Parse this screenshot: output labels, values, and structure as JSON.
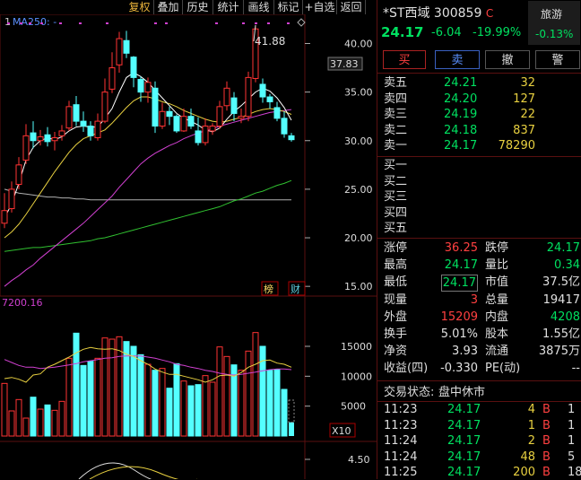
{
  "toolbar": {
    "items": [
      "复权",
      "叠加",
      "历史",
      "统计",
      "画线",
      "标记",
      "+自选",
      "返回"
    ]
  },
  "chart": {
    "indicator_marker": "1",
    "ma_label": "MA250: -",
    "price_axis": [
      "40.00",
      "35.00",
      "30.00",
      "25.00",
      "20.00",
      "15.00"
    ],
    "current_price_tag": "37.83",
    "high_annotation": "41.88",
    "badge_bang": "榜",
    "badge_cai": "财",
    "volume_header": "7200.16",
    "volume_axis": [
      "15000",
      "10000",
      "5000"
    ],
    "volume_unit": "X10",
    "lower_axis": "4.50"
  },
  "chart_data": {
    "type": "candlestick",
    "ylim": [
      14,
      43
    ],
    "candles": [
      [
        21.5,
        22.8,
        24.6,
        21.0
      ],
      [
        23.0,
        25.0,
        25.8,
        22.6
      ],
      [
        25.5,
        27.5,
        28.3,
        25.0
      ],
      [
        28.0,
        30.5,
        31.7,
        27.6
      ],
      [
        30.8,
        30.0,
        32.0,
        29.2
      ],
      [
        30.0,
        30.4,
        31.1,
        29.5
      ],
      [
        30.6,
        29.9,
        31.4,
        29.4
      ],
      [
        30.0,
        30.3,
        30.9,
        29.0
      ],
      [
        30.5,
        31.0,
        31.6,
        30.0
      ],
      [
        31.3,
        33.5,
        34.1,
        31.0
      ],
      [
        33.7,
        32.0,
        34.6,
        31.5
      ],
      [
        32.0,
        31.5,
        33.0,
        30.9
      ],
      [
        31.5,
        30.5,
        32.0,
        30.0
      ],
      [
        30.3,
        32.0,
        32.8,
        30.0
      ],
      [
        32.0,
        35.0,
        36.4,
        31.8
      ],
      [
        35.3,
        37.5,
        39.1,
        34.9
      ],
      [
        37.8,
        40.5,
        41.2,
        37.0
      ],
      [
        40.3,
        39.0,
        41.3,
        38.5
      ],
      [
        38.6,
        36.5,
        38.7,
        35.5
      ],
      [
        36.3,
        35.0,
        36.6,
        34.0
      ],
      [
        35.0,
        36.0,
        36.5,
        33.9
      ],
      [
        35.4,
        31.5,
        36.1,
        30.8
      ],
      [
        31.5,
        33.0,
        33.9,
        31.2
      ],
      [
        33.0,
        32.5,
        33.5,
        31.6
      ],
      [
        32.5,
        31.0,
        32.7,
        30.8
      ],
      [
        31.0,
        32.5,
        33.3,
        30.9
      ],
      [
        32.5,
        31.5,
        33.3,
        31.2
      ],
      [
        31.0,
        29.8,
        32.4,
        29.5
      ],
      [
        29.8,
        31.5,
        32.3,
        29.5
      ],
      [
        31.0,
        31.5,
        31.8,
        30.6
      ],
      [
        31.5,
        33.5,
        34.1,
        31.2
      ],
      [
        33.6,
        35.4,
        36.1,
        33.1
      ],
      [
        34.4,
        32.8,
        35.0,
        32.0
      ],
      [
        32.3,
        32.5,
        33.3,
        31.8
      ],
      [
        32.5,
        36.5,
        37.1,
        32.0
      ],
      [
        36.4,
        41.5,
        41.9,
        36.0
      ],
      [
        35.8,
        34.5,
        36.4,
        33.9
      ],
      [
        34.5,
        34.0,
        34.8,
        33.3
      ],
      [
        33.4,
        32.3,
        34.0,
        32.0
      ],
      [
        32.3,
        30.7,
        33.0,
        30.3
      ],
      [
        30.5,
        30.1,
        30.8,
        29.9
      ]
    ],
    "ma5": [
      22.0,
      23.5,
      25.6,
      28.0,
      29.3,
      30.0,
      30.3,
      30.1,
      30.4,
      31.0,
      31.4,
      31.5,
      31.4,
      31.4,
      32.3,
      33.3,
      35.0,
      36.5,
      37.0,
      36.6,
      36.0,
      35.2,
      34.4,
      33.6,
      32.8,
      32.3,
      32.0,
      31.6,
      31.1,
      30.9,
      31.3,
      32.2,
      33.0,
      33.6,
      34.3,
      35.0,
      35.4,
      35.1,
      34.4,
      33.4,
      32.1
    ],
    "ma10": [
      20.0,
      20.6,
      21.4,
      22.4,
      23.5,
      24.6,
      25.7,
      26.8,
      27.8,
      28.8,
      29.6,
      30.2,
      30.5,
      30.8,
      31.1,
      31.8,
      32.6,
      33.4,
      34.1,
      34.5,
      34.5,
      34.3,
      34.0,
      33.8,
      33.5,
      33.1,
      32.8,
      32.5,
      32.2,
      32.0,
      31.9,
      32.0,
      32.2,
      32.4,
      32.7,
      33.0,
      33.2,
      33.3,
      33.2,
      33.0,
      32.7
    ],
    "ma30": [
      15.0,
      15.6,
      16.1,
      16.7,
      17.2,
      17.9,
      18.5,
      19.1,
      19.7,
      20.3,
      20.9,
      21.5,
      22.2,
      22.9,
      23.6,
      24.3,
      25.2,
      26.0,
      26.8,
      27.6,
      28.2,
      28.7,
      29.1,
      29.5,
      29.8,
      30.2,
      30.5,
      30.8,
      31.0,
      31.2,
      31.5,
      31.7,
      31.9,
      32.1,
      32.3,
      32.5,
      32.7,
      32.9,
      33.0,
      33.1,
      33.2
    ],
    "ma60": [
      18.6,
      18.7,
      18.8,
      18.9,
      19.0,
      19.0,
      19.1,
      19.2,
      19.3,
      19.4,
      19.5,
      19.6,
      19.7,
      19.9,
      20.0,
      20.2,
      20.4,
      20.6,
      20.8,
      21.0,
      21.2,
      21.4,
      21.6,
      21.8,
      22.0,
      22.2,
      22.4,
      22.6,
      22.8,
      23.0,
      23.2,
      23.5,
      23.8,
      24.0,
      24.3,
      24.6,
      24.8,
      25.1,
      25.4,
      25.6,
      25.9
    ],
    "ma120": [
      25.0,
      24.8,
      24.6,
      24.5,
      24.4,
      24.3,
      24.2,
      24.2,
      24.1,
      24.1,
      24.0,
      24.0,
      23.9,
      23.9,
      23.9,
      23.9,
      23.9,
      23.9,
      23.9,
      23.9,
      23.9,
      23.9,
      23.9,
      23.9,
      23.9,
      23.9,
      23.9,
      23.9,
      23.9,
      23.9,
      23.9,
      23.9,
      23.9,
      23.9,
      23.9,
      23.9,
      23.9,
      23.9,
      23.9,
      23.9,
      23.9
    ],
    "volume": [
      8800,
      4200,
      6100,
      3000,
      6500,
      4500,
      5200,
      4300,
      5800,
      13000,
      17200,
      11800,
      12500,
      13000,
      16400,
      16200,
      16600,
      15800,
      15000,
      13600,
      12000,
      11000,
      11300,
      8000,
      12100,
      9200,
      8400,
      8600,
      10100,
      9000,
      14900,
      13300,
      11900,
      11000,
      14200,
      17300,
      15000,
      11000,
      11100,
      7800,
      2300
    ],
    "vol_ma5": [
      9600,
      9800,
      9500,
      9000,
      10200,
      10400,
      11500,
      12000,
      12600,
      13200,
      13900,
      14500,
      14800,
      14600,
      14500,
      14600,
      14300,
      13700,
      13300,
      12600,
      12000,
      11200,
      10700,
      10300,
      10300,
      10000,
      9700,
      9400,
      9000,
      9400,
      10100,
      10200,
      10000,
      10600,
      11500,
      12000,
      12600,
      12700,
      12200,
      12000,
      11500
    ],
    "vol_ma10": [
      12800,
      12300,
      11800,
      11500,
      11500,
      11300,
      11400,
      11500,
      11700,
      11900,
      12100,
      12400,
      12600,
      12800,
      13000,
      13100,
      13300,
      13400,
      13400,
      13400,
      13200,
      13000,
      12700,
      12400,
      12000,
      11800,
      11500,
      11300,
      11000,
      10800,
      10500,
      10300,
      10200,
      10300,
      10500,
      10700,
      10900,
      11100,
      11200,
      11200,
      11100
    ],
    "vol_ylim": [
      0,
      21000
    ]
  },
  "stock": {
    "name": "*ST西域",
    "code": "300859",
    "flag": "C",
    "price": "24.17",
    "change": "-6.04",
    "pct": "-19.99%",
    "sector_name": "旅游",
    "sector_pct": "-0.13%"
  },
  "trade_buttons": [
    "买",
    "卖",
    "撤",
    "警"
  ],
  "asks": [
    {
      "label": "卖五",
      "price": "24.21",
      "vol": "32"
    },
    {
      "label": "卖四",
      "price": "24.20",
      "vol": "127"
    },
    {
      "label": "卖三",
      "price": "24.19",
      "vol": "22"
    },
    {
      "label": "卖二",
      "price": "24.18",
      "vol": "837"
    },
    {
      "label": "卖一",
      "price": "24.17",
      "vol": "78290"
    }
  ],
  "bids": [
    {
      "label": "买一"
    },
    {
      "label": "买二"
    },
    {
      "label": "买三"
    },
    {
      "label": "买四"
    },
    {
      "label": "买五"
    }
  ],
  "stats": [
    {
      "l1": "涨停",
      "v1": "36.25",
      "c1": "red",
      "l2": "跌停",
      "v2": "24.17",
      "c2": "green"
    },
    {
      "l1": "最高",
      "v1": "24.17",
      "c1": "green",
      "l2": "量比",
      "v2": "0.34",
      "c2": "green"
    },
    {
      "l1": "最低",
      "v1": "24.17",
      "c1": "green",
      "l2": "市值",
      "v2": "37.5亿",
      "c2": "white"
    },
    {
      "l1": "现量",
      "v1": "3",
      "c1": "red",
      "l2": "总量",
      "v2": "19417",
      "c2": "white"
    },
    {
      "l1": "外盘",
      "v1": "15209",
      "c1": "red",
      "l2": "内盘",
      "v2": "4208",
      "c2": "green"
    },
    {
      "l1": "换手",
      "v1": "5.01%",
      "c1": "white",
      "l2": "股本",
      "v2": "1.55亿",
      "c2": "white"
    },
    {
      "l1": "净资",
      "v1": "3.93",
      "c1": "white",
      "l2": "流通",
      "v2": "3875万",
      "c2": "white"
    },
    {
      "l1": "收益(四)",
      "v1": "-0.330",
      "c1": "white",
      "l2": "PE(动)",
      "v2": "--",
      "c2": "white"
    }
  ],
  "status": {
    "label": "交易状态:",
    "value": "盘中休市"
  },
  "ticks": [
    {
      "time": "11:23",
      "price": "24.17",
      "vol": "4",
      "side": "B",
      "extra": "1"
    },
    {
      "time": "11:23",
      "price": "24.17",
      "vol": "1",
      "side": "B",
      "extra": "1"
    },
    {
      "time": "11:24",
      "price": "24.17",
      "vol": "2",
      "side": "B",
      "extra": "1"
    },
    {
      "time": "11:24",
      "price": "24.17",
      "vol": "48",
      "side": "B",
      "extra": "5"
    },
    {
      "time": "11:25",
      "price": "24.17",
      "vol": "200",
      "side": "B",
      "extra": "18"
    }
  ],
  "colors": {
    "up": "#ff3333",
    "down": "#54ffff",
    "ma5": "#ffffff",
    "ma10": "#e8d040",
    "ma30": "#d040d0",
    "ma60": "#30c030",
    "ma120": "#b0b0b0"
  }
}
